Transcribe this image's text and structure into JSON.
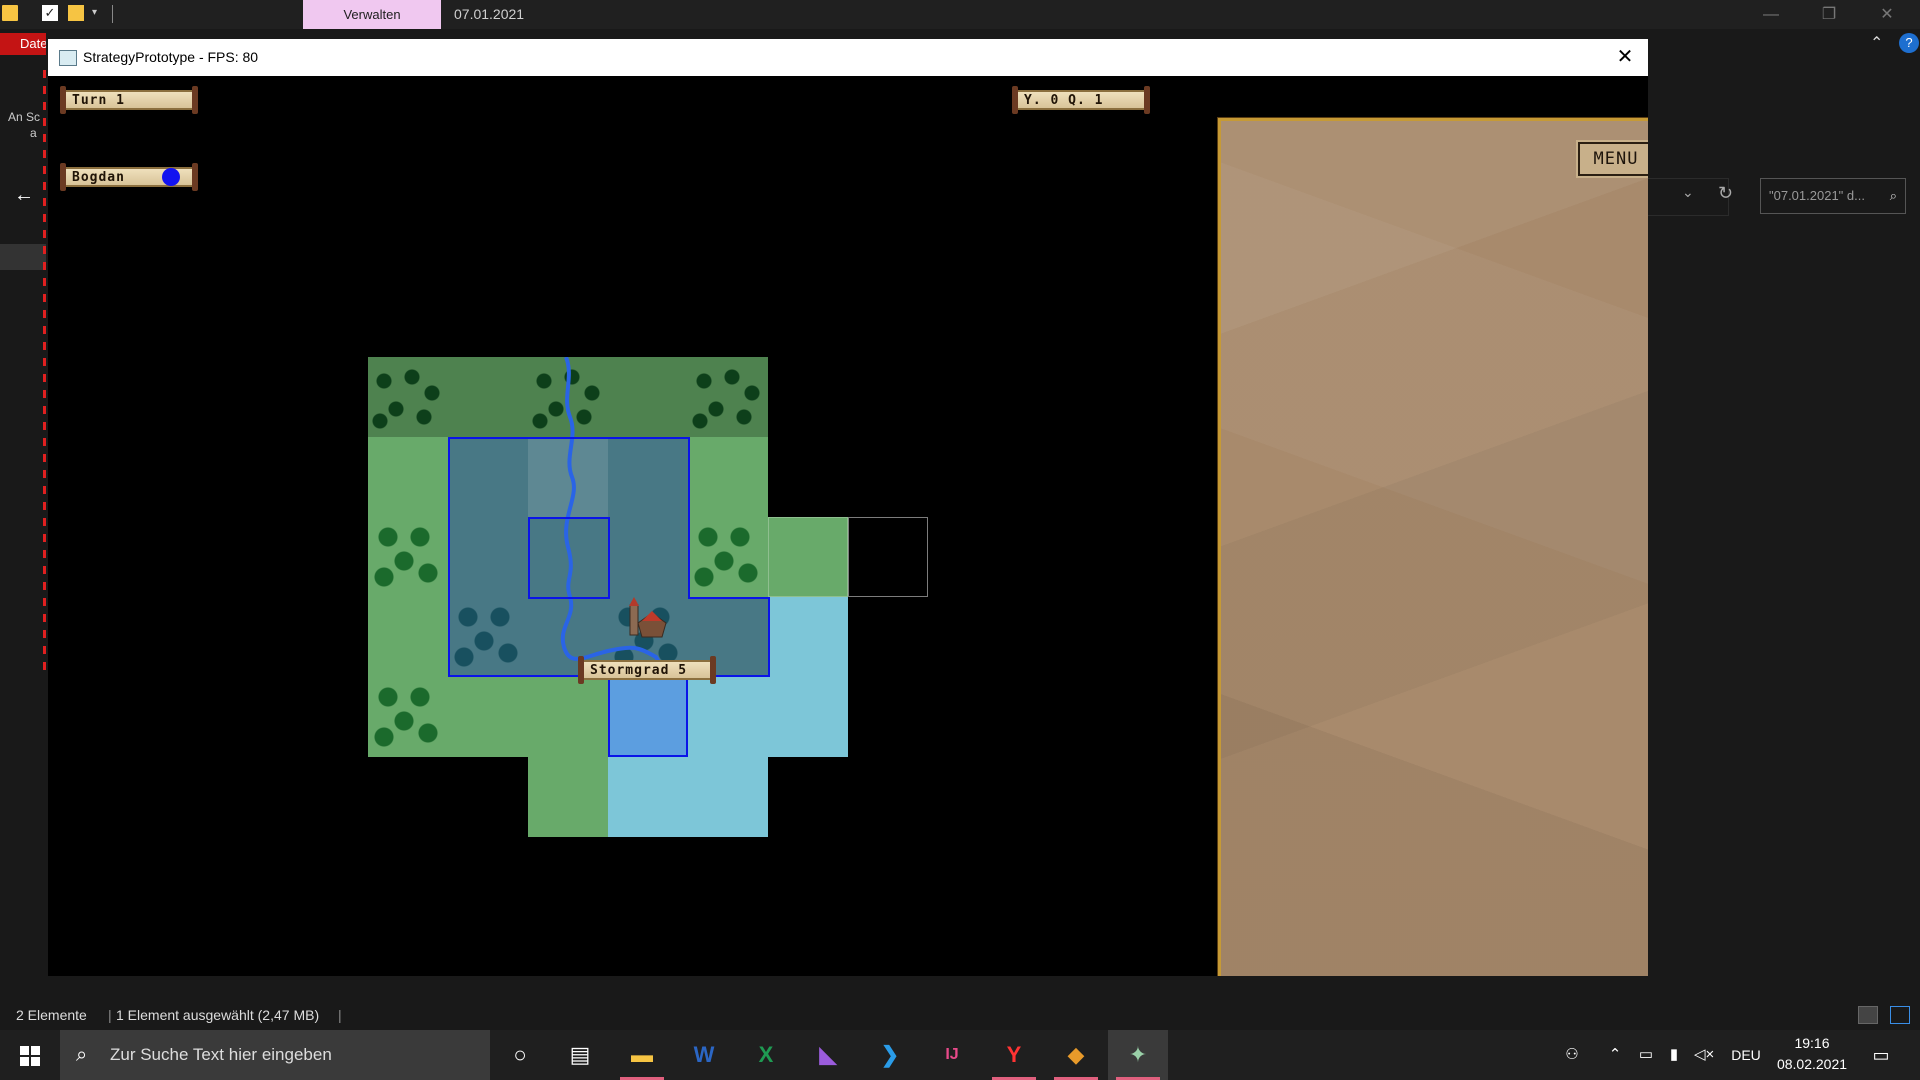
{
  "explorer": {
    "context_tab": "Verwalten",
    "title": "07.01.2021",
    "file_tab": "Datei",
    "side_text": [
      "An Sc",
      "a"
    ],
    "search_placeholder": "\"07.01.2021\" d...",
    "status": {
      "items": "2 Elemente",
      "selection": "1 Element ausgewählt (2,47 MB)"
    }
  },
  "game_window": {
    "title": "StrategyPrototype - FPS: 80",
    "turn_label": "Turn 1",
    "player_name": "Bogdan",
    "player_color": "#1212f0",
    "resources_label": "Y. 0 Q. 1",
    "city_label": "Stormgrad 5",
    "menu_label": "MENU",
    "colors": {
      "territory_border": "#0a14e8",
      "grass": "#68aa6a",
      "water": "#7dc6d8",
      "panel_frame": "#c69a35"
    }
  },
  "taskbar": {
    "search_placeholder": "Zur Suche Text hier eingeben",
    "apps": [
      "cortana-icon",
      "task-view-icon",
      "file-explorer-icon",
      "word-icon",
      "excel-icon",
      "visual-studio-icon",
      "vscode-icon",
      "intellij-icon",
      "yandex-browser-icon",
      "git-kraken-icon",
      "game-icon"
    ],
    "language": "DEU",
    "time": "19:16",
    "date": "08.02.2021"
  }
}
